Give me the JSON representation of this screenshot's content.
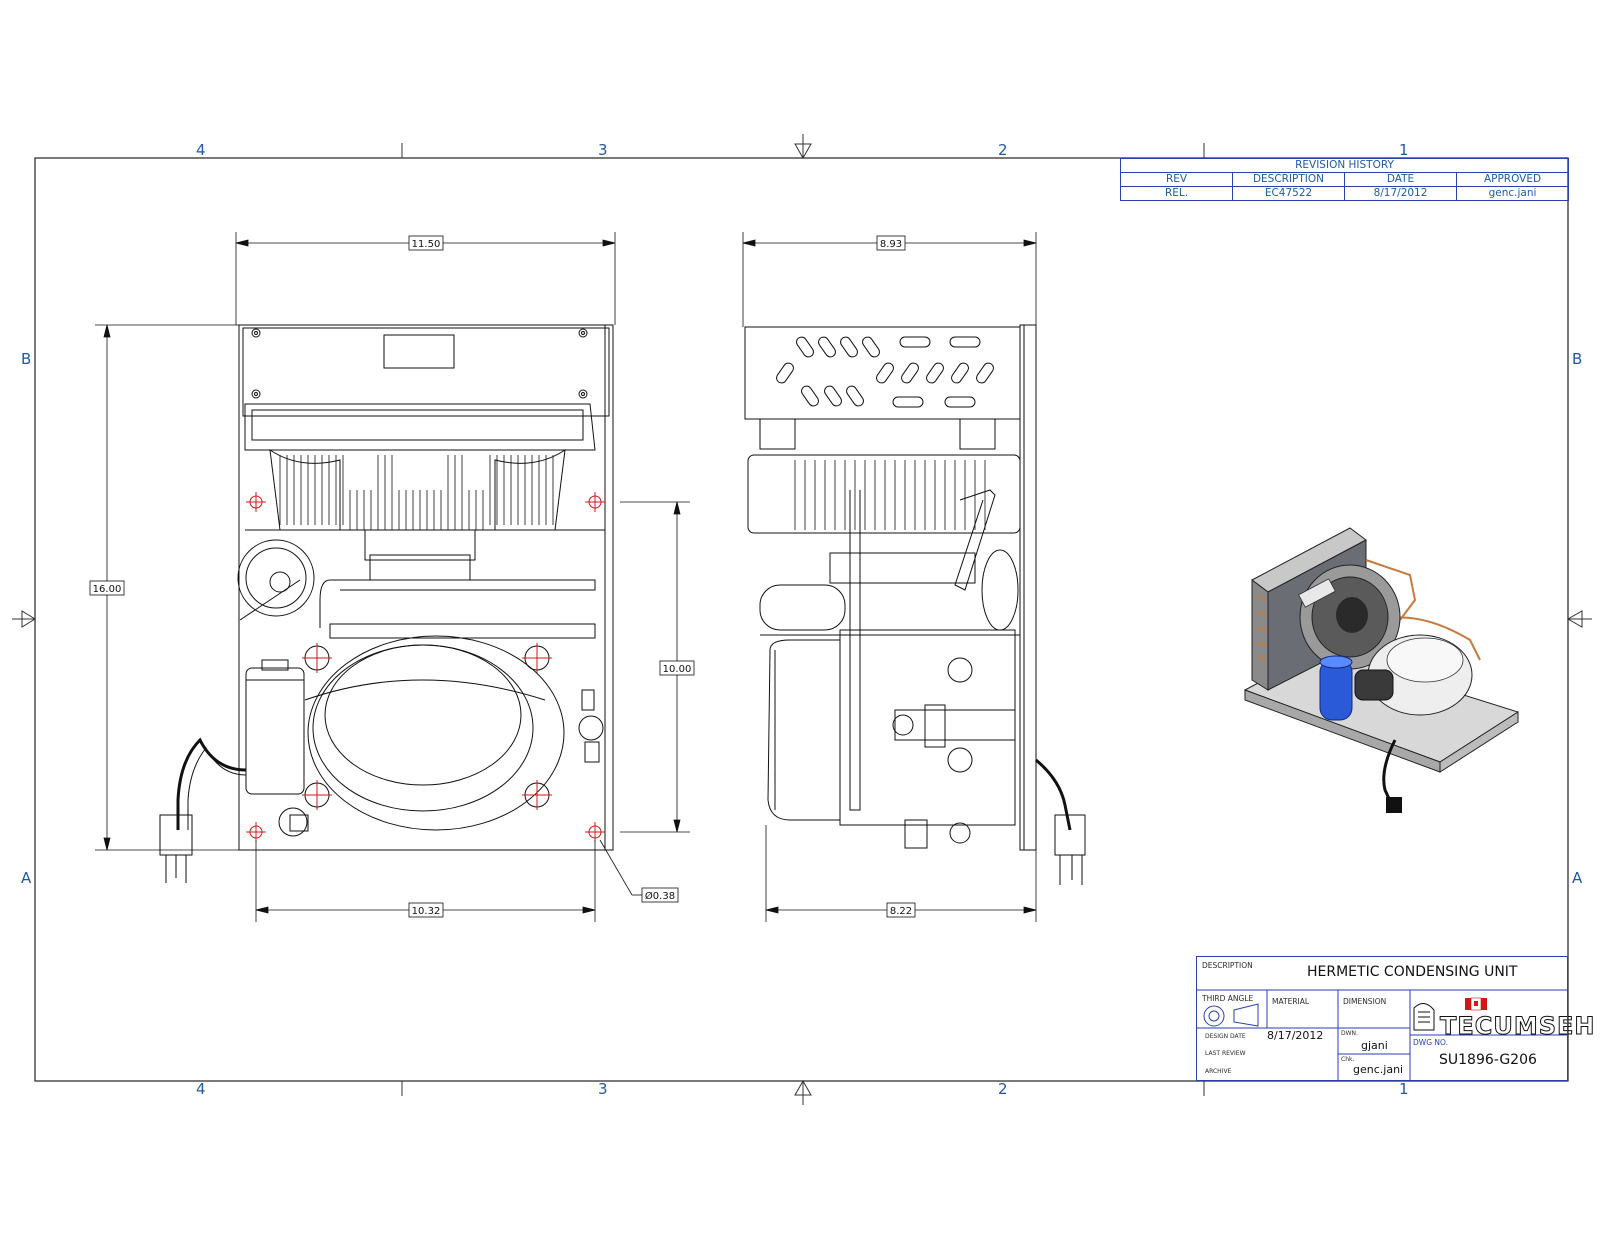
{
  "zones": {
    "columns": [
      "4",
      "3",
      "2",
      "1"
    ],
    "rows": [
      "B",
      "A"
    ]
  },
  "revision_history": {
    "title": "REVISION HISTORY",
    "headers": [
      "REV",
      "DESCRIPTION",
      "DATE",
      "APPROVED"
    ],
    "rows": [
      [
        "REL.",
        "EC47522",
        "8/17/2012",
        "genc.jani"
      ]
    ]
  },
  "dimensions": {
    "front_width_top": "11.50",
    "front_height": "16.00",
    "front_width_bottom": "10.32",
    "side_width_top": "8.93",
    "side_height": "10.00",
    "side_width_bottom": "8.22",
    "hole_diameter": "Ø0.38"
  },
  "title_block": {
    "description_label": "DESCRIPTION",
    "description": "HERMETIC CONDENSING UNIT",
    "third_angle_label": "THIRD ANGLE",
    "material_label": "MATERIAL",
    "dimension_label": "DIMENSION",
    "design_date_label": "DESIGN DATE",
    "design_date": "8/17/2012",
    "last_review_label": "LAST REVIEW",
    "archive_label": "ARCHIVE",
    "drawn_label": "DWN.",
    "drawn": "gjani",
    "checked_label": "Chk.",
    "checked": "genc.jani",
    "dwg_no_label": "DWG NO.",
    "dwg_no": "SU1896-G206",
    "logo_text": "TECUMSEH"
  },
  "colors": {
    "border": "#1f2a44",
    "zone_text": "#1f5aa6",
    "title_border": "#2a3fb0",
    "center_mark": "#d01818",
    "copper": "#c87a3e",
    "accumulator": "#2a5ad8"
  }
}
